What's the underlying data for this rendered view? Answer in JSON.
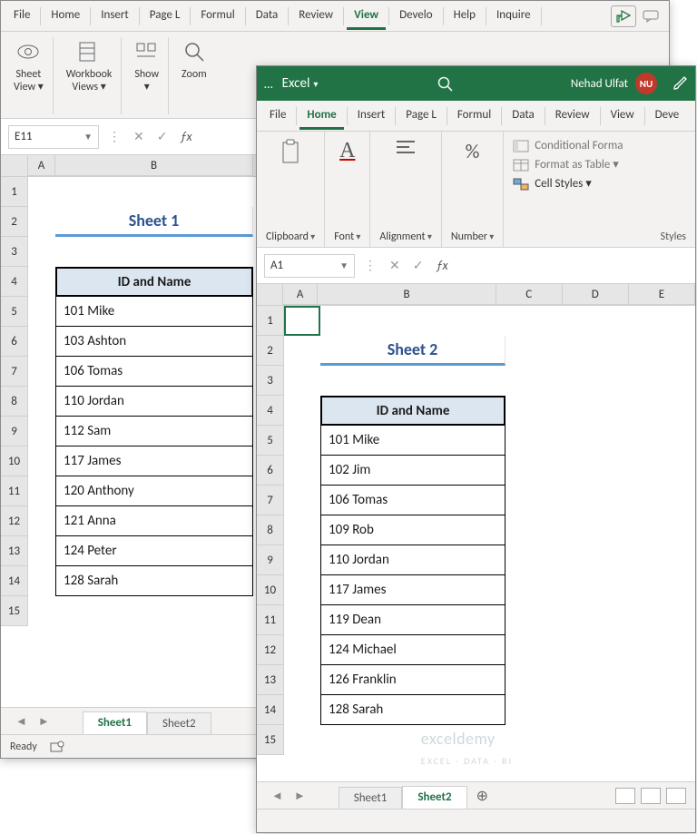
{
  "tabs1": {
    "file": "File",
    "home": "Home",
    "insert": "Insert",
    "page": "Page L",
    "formulas": "Formul",
    "data": "Data",
    "review": "Review",
    "view": "View",
    "developer": "Develo",
    "help": "Help",
    "inquire": "Inquire"
  },
  "ribbon1": {
    "sheetview": "Sheet\nView ▾",
    "workbookviews": "Workbook\nViews ▾",
    "show": "Show\n▾",
    "zoom": "Zoom"
  },
  "namebox1": "E11",
  "sheet1": {
    "title": "Sheet 1",
    "header": "ID and Name",
    "rows": [
      "101 Mike",
      "103 Ashton",
      "106 Tomas",
      "110 Jordan",
      "112 Sam",
      "117 James",
      "120 Anthony",
      "121 Anna",
      "124 Peter",
      "128 Sarah"
    ]
  },
  "sheettabs1": {
    "t1": "Sheet1",
    "t2": "Sheet2"
  },
  "status1": {
    "ready": "Ready"
  },
  "titlebar2": {
    "app": "Excel",
    "user": "Nehad Ulfat",
    "initials": "NU",
    "dots": "…"
  },
  "tabs2": {
    "file": "File",
    "home": "Home",
    "insert": "Insert",
    "page": "Page L",
    "formulas": "Formul",
    "data": "Data",
    "review": "Review",
    "view": "View",
    "developer": "Deve"
  },
  "ribbon2": {
    "clipboard": "Clipboard",
    "font": "Font",
    "alignment": "Alignment",
    "number": "Number",
    "cf": "Conditional Forma",
    "fat": "Format as Table ▾",
    "cs": "Cell Styles ▾",
    "styles": "Styles"
  },
  "namebox2": "A1",
  "sheet2": {
    "title": "Sheet 2",
    "header": "ID and Name",
    "rows": [
      "101 Mike",
      "102 Jim",
      "106 Tomas",
      "109 Rob",
      "110 Jordan",
      "117 James",
      "119 Dean",
      "124 Michael",
      "126 Franklin",
      "128 Sarah"
    ]
  },
  "sheettabs2": {
    "t1": "Sheet1",
    "t2": "Sheet2"
  },
  "watermark": {
    "brand": "exceldemy",
    "sub": "EXCEL · DATA · BI"
  },
  "cols1": {
    "A": "A",
    "B": "B"
  },
  "cols2": {
    "A": "A",
    "B": "B",
    "C": "C",
    "D": "D",
    "E": "E"
  }
}
